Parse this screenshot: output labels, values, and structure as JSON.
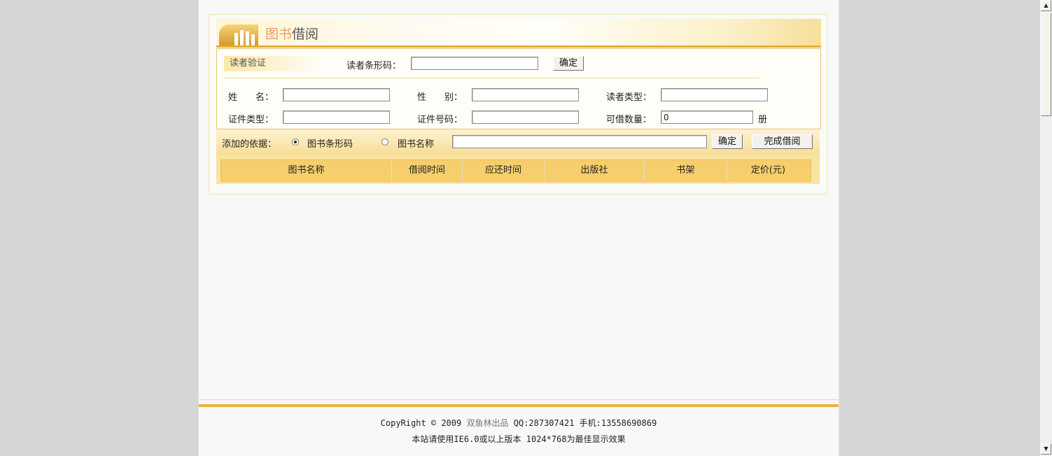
{
  "panel": {
    "title_part1": "图书",
    "title_part2": "借阅"
  },
  "reader_section": {
    "label": "读者验证",
    "barcode_label": "读者条形码：",
    "barcode_value": "",
    "confirm_button": "确定",
    "name_label": "姓　　名：",
    "name_value": "",
    "gender_label": "性　　别：",
    "gender_value": "",
    "reader_type_label": "读者类型：",
    "reader_type_value": "",
    "id_type_label": "证件类型：",
    "id_type_value": "",
    "id_number_label": "证件号码：",
    "id_number_value": "",
    "borrowable_label": "可借数量：",
    "borrowable_value": "0",
    "borrowable_unit": "册"
  },
  "add_section": {
    "label": "添加的依据：",
    "option_barcode": "图书条形码",
    "option_name": "图书名称",
    "selected": "图书条形码",
    "input_value": "",
    "confirm_button": "确定",
    "finish_button": "完成借阅"
  },
  "table": {
    "columns": [
      "图书名称",
      "借阅时间",
      "应还时间",
      "出版社",
      "书架",
      "定价(元)"
    ]
  },
  "footer": {
    "copyright": "CopyRight © 2009",
    "brand": "双鱼林出品",
    "contact": "QQ:287307421 手机:13558690869",
    "note": "本站请使用IE6.0或以上版本 1024*768为最佳显示效果"
  },
  "colors": {
    "accent": "#e3ae3a",
    "header_fill": "#f6cf6c",
    "title_orange": "#e6a064"
  },
  "icons": {
    "title_icon": "books-icon",
    "scroll_up": "scroll-up-arrow-icon",
    "scroll_down": "scroll-down-arrow-icon"
  }
}
